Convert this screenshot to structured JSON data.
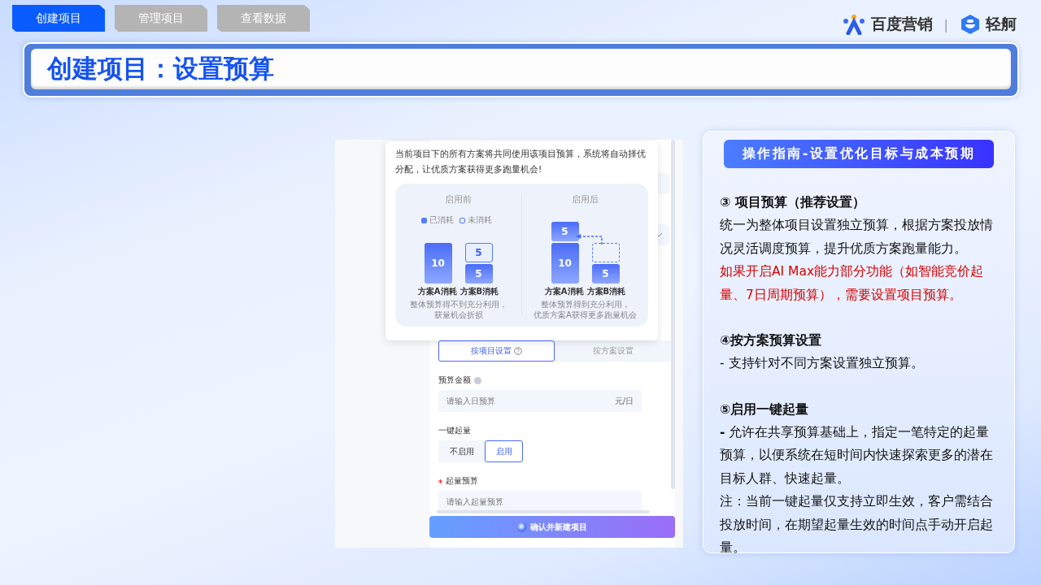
{
  "nav_tabs": [
    {
      "label": "创建项目",
      "selected": true
    },
    {
      "label": "管理项目",
      "selected": false
    },
    {
      "label": "查看数据",
      "selected": false
    }
  ],
  "brand": {
    "name": "百度营销",
    "separator": "|",
    "product": "轻舸"
  },
  "title": "创建项目：设置预算",
  "screenshot": {
    "popover": {
      "text": "当前项目下的所有方案将共同使用该项目预算，系统将自动择优分配，让优质方案获得更多跑量机会!",
      "panels": [
        {
          "title": "启用前",
          "legend": [
            {
              "kind": "used",
              "label": "已消耗"
            },
            {
              "kind": "unused",
              "label": "未消耗"
            }
          ],
          "bars": [
            {
              "label": "方案A消耗",
              "segments": [
                {
                  "kind": "used_tall",
                  "value": "10"
                }
              ]
            },
            {
              "label": "方案B消耗",
              "segments": [
                {
                  "kind": "unused",
                  "value": "5"
                },
                {
                  "kind": "used",
                  "value": "5"
                }
              ]
            }
          ],
          "caption": [
            "整体预算得不到充分利用，",
            "获量机会折损"
          ],
          "transfer_arrow": false
        },
        {
          "title": "启用后",
          "bars": [
            {
              "label": "方案A消耗",
              "segments": [
                {
                  "kind": "used",
                  "value": "5"
                },
                {
                  "kind": "used_tall",
                  "value": "10"
                }
              ]
            },
            {
              "label": "方案B消耗",
              "segments": [
                {
                  "kind": "empty"
                },
                {
                  "kind": "used",
                  "value": "5"
                }
              ]
            }
          ],
          "caption": [
            "整体预算得到充分利用，",
            "优质方案A获得更多跑量机会"
          ],
          "transfer_arrow": true
        }
      ]
    },
    "settings_tabs": [
      {
        "label": "按项目设置",
        "selected": true,
        "help": true
      },
      {
        "label": "按方案设置",
        "selected": false,
        "help": false
      }
    ],
    "fields": [
      {
        "kind": "input",
        "label": "预算金额",
        "info": true,
        "required": false,
        "placeholder": "请输入日预算",
        "suffix": "元/日"
      },
      {
        "kind": "toggle",
        "label": "一键起量",
        "info": false,
        "required": false,
        "options": [
          {
            "label": "不启用",
            "selected": false
          },
          {
            "label": "启用",
            "selected": true
          }
        ]
      },
      {
        "kind": "input",
        "label": "起量预算",
        "info": false,
        "required": true,
        "placeholder": "请输入起量预算"
      }
    ],
    "submit": "确认并新建项目"
  },
  "guide": {
    "title": "操作指南-设置优化目标与成本预期",
    "sections": [
      {
        "heading": "③ 项目预算（推荐设置）",
        "paragraphs": [
          {
            "kind": "normal",
            "text": "统一为整体项目设置独立预算，根据方案投放情况灵活调度预算，提升优质方案跑量能力。"
          },
          {
            "kind": "warning",
            "text": "如果开启AI Max能力部分功能（如智能竞价起量、7日周期预算），需要设置项目预算。"
          }
        ]
      },
      {
        "heading": "④按方案预算设置",
        "paragraphs": [
          {
            "kind": "normal",
            "text": "- 支持针对不同方案设置独立预算。"
          }
        ]
      },
      {
        "heading": "⑤启用一键起量",
        "paragraphs": [
          {
            "kind": "normal",
            "text": "**-** 允许在共享预算基础上，指定一笔特定的起量预算，以便系统在短时间内快速探索更多的潜在目标人群、快速起量。"
          },
          {
            "kind": "normal",
            "text": "注：当前一键起量仅支持立即生效，客户需结合投放时间，在期望起量生效的时间点手动开启起量。"
          }
        ]
      }
    ]
  }
}
